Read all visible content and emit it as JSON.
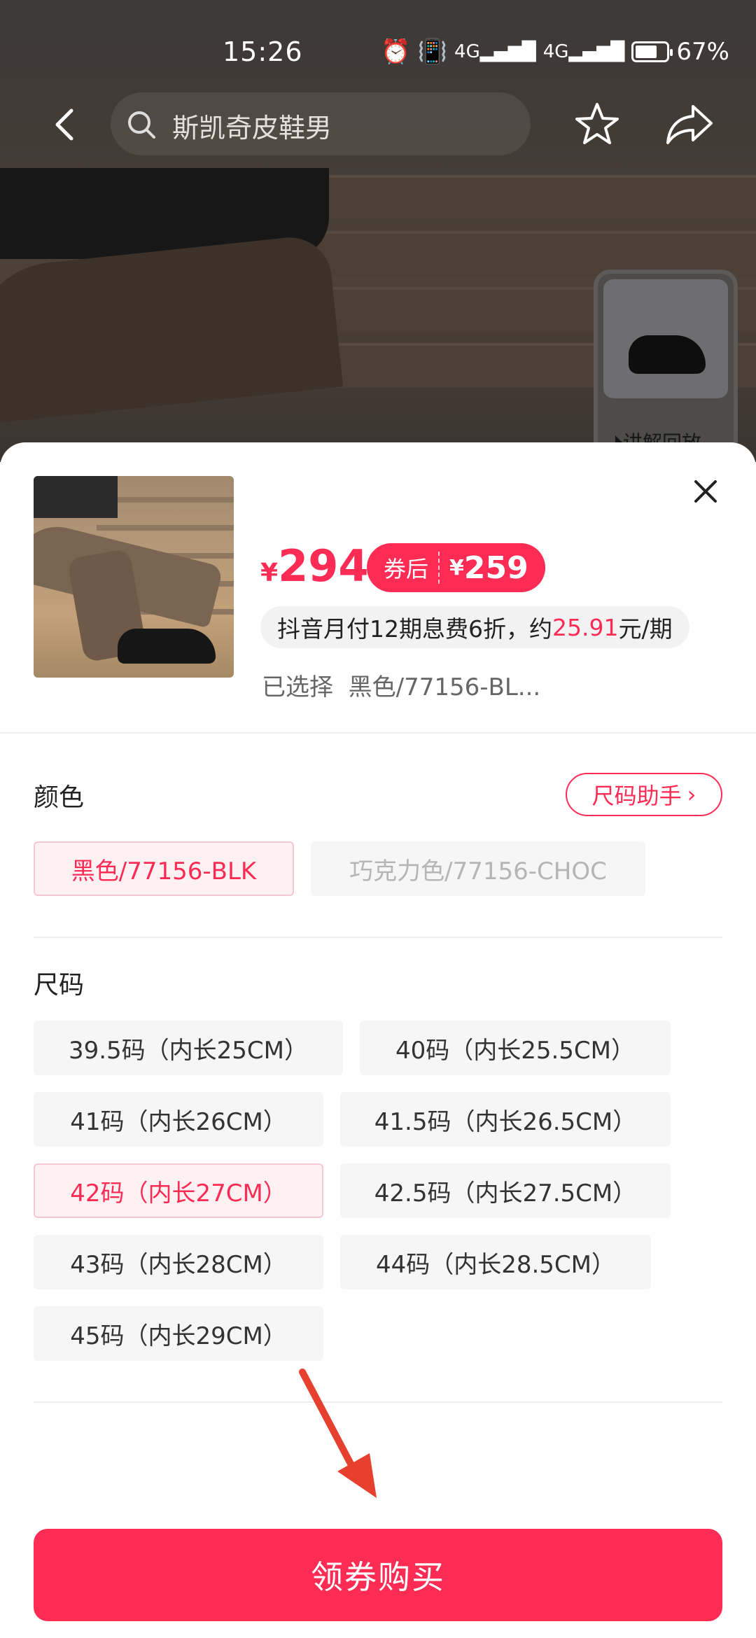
{
  "status_bar": {
    "time": "15:26",
    "net1": "4G",
    "net2": "4G",
    "battery": "67%"
  },
  "nav": {
    "search_placeholder": "斯凯奇皮鞋男"
  },
  "hero": {
    "replay_label": "讲解回放"
  },
  "product": {
    "currency": "¥",
    "price": "294",
    "coupon_tag": "券后",
    "coupon_currency": "¥",
    "coupon_price": "259",
    "install_prefix": "抖音月付12期息费6折，约",
    "install_amount": "25.91",
    "install_suffix": "元/期",
    "selected_label": "已选择",
    "selected_value": "黑色/77156-BL..."
  },
  "color_section": {
    "title": "颜色",
    "helper": "尺码助手",
    "options": [
      "黑色/77156-BLK",
      "巧克力色/77156-CHOC"
    ]
  },
  "size_section": {
    "title": "尺码",
    "options": [
      "39.5码（内长25CM）",
      "40码（内长25.5CM）",
      "41码（内长26CM）",
      "41.5码（内长26.5CM）",
      "42码（内长27CM）",
      "42.5码（内长27.5CM）",
      "43码（内长28CM）",
      "44码（内长28.5CM）",
      "45码（内长29CM）"
    ]
  },
  "cta": {
    "label": "领券购买"
  },
  "colors": {
    "accent": "#fe2c55"
  },
  "icons": [
    "back-icon",
    "search-icon",
    "star-icon",
    "share-icon",
    "close-icon",
    "play-icon",
    "chevron-right-icon"
  ]
}
